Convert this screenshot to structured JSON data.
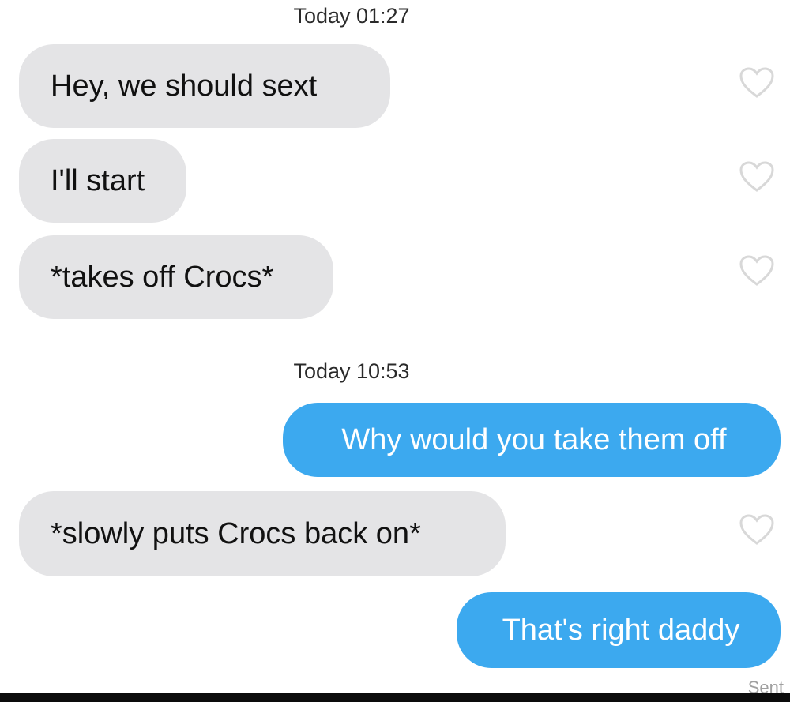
{
  "conversation": {
    "timestamps": [
      "Today 01:27",
      "Today 10:53"
    ],
    "messages": [
      {
        "sender": "them",
        "text": "Hey, we should sext",
        "liked": false
      },
      {
        "sender": "them",
        "text": "I'll start",
        "liked": false
      },
      {
        "sender": "them",
        "text": "*takes off Crocs*",
        "liked": false
      },
      {
        "sender": "me",
        "text": "Why would you take them off"
      },
      {
        "sender": "them",
        "text": "*slowly puts Crocs back on*",
        "liked": false
      },
      {
        "sender": "me",
        "text": "That's right daddy"
      }
    ],
    "status": "Sent"
  },
  "icons": {
    "like": "heart-outline-icon"
  },
  "colors": {
    "incoming_bubble": "#e4e4e6",
    "outgoing_bubble": "#3ca9ef",
    "heart_outline": "#d8d8d8"
  }
}
